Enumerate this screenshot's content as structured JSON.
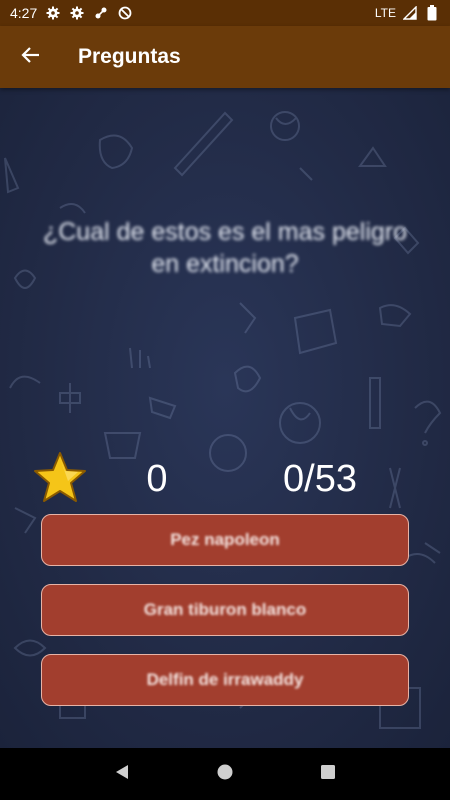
{
  "status_bar": {
    "time": "4:27",
    "network": "LTE",
    "icons": [
      "gear-icon",
      "gear-icon",
      "sync-icon",
      "do-not-disturb-icon",
      "signal-icon",
      "battery-icon"
    ]
  },
  "app_bar": {
    "title": "Preguntas",
    "back_icon": "arrow-left-icon"
  },
  "quiz": {
    "question": "¿Cual de estos es el mas peligro en extincion?",
    "score": "0",
    "counter": "0/53",
    "answers": [
      {
        "label": "Pez napoleon"
      },
      {
        "label": "Gran tiburon blanco"
      },
      {
        "label": "Delfin de irrawaddy"
      }
    ]
  },
  "nav_bar": {
    "buttons": [
      "back-triangle-icon",
      "home-circle-icon",
      "recents-square-icon"
    ]
  },
  "colors": {
    "status_bar": "#5a2f05",
    "app_bar": "#6b3b0a",
    "background": "#222b47",
    "answer_button": "#a23e2e",
    "star": "#f5c518"
  }
}
